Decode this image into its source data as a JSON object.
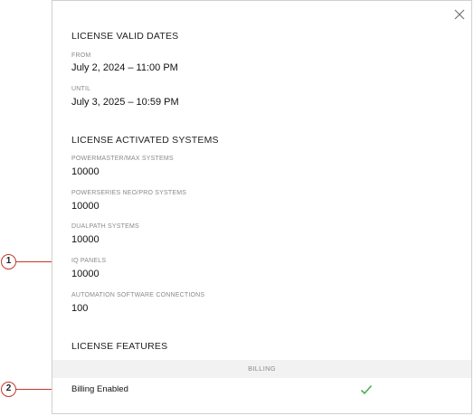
{
  "dialog": {
    "close_label": "×",
    "valid_dates": {
      "title": "LICENSE VALID DATES",
      "from_label": "FROM",
      "from_value": "July 2, 2024 – 11:00 PM",
      "until_label": "UNTIL",
      "until_value": "July 3, 2025 – 10:59 PM"
    },
    "activated_systems": {
      "title": "LICENSE ACTIVATED SYSTEMS",
      "items": [
        {
          "label": "POWERMASTER/MAX SYSTEMS",
          "value": "10000"
        },
        {
          "label": "POWERSERIES NEO/PRO SYSTEMS",
          "value": "10000"
        },
        {
          "label": "DUALPATH SYSTEMS",
          "value": "10000"
        },
        {
          "label": "IQ PANELS",
          "value": "10000"
        },
        {
          "label": "AUTOMATION SOFTWARE CONNECTIONS",
          "value": "100"
        }
      ]
    },
    "features": {
      "title": "LICENSE FEATURES",
      "group_header": "BILLING",
      "items": [
        {
          "label": "Billing Enabled",
          "enabled": true
        }
      ]
    }
  },
  "callouts": [
    "1",
    "2"
  ],
  "colors": {
    "callout_red": "#c0392b",
    "check_green": "#4caf50",
    "band_bg": "#f2f2f2"
  }
}
